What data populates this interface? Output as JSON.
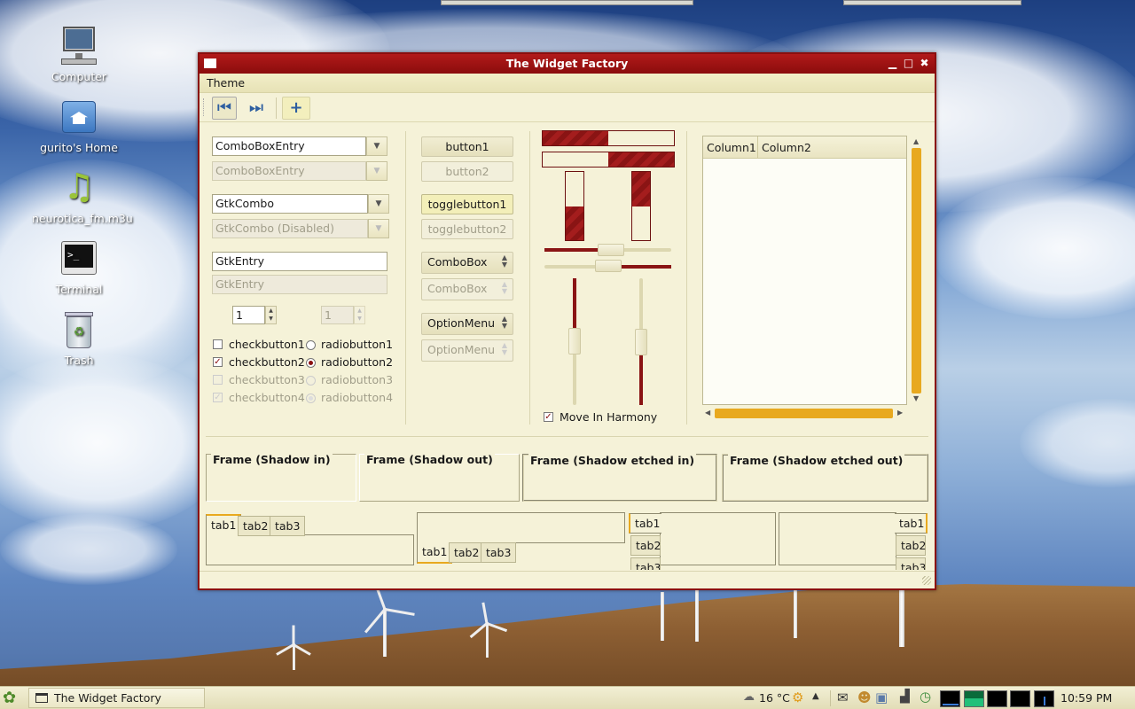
{
  "desktop": {
    "icons": [
      {
        "label": "Computer",
        "icon": "computer-icon"
      },
      {
        "label": "gurito's Home",
        "icon": "home-folder-icon"
      },
      {
        "label": "neurotica_fm.m3u",
        "icon": "music-file-icon"
      },
      {
        "label": "Terminal",
        "icon": "terminal-icon"
      },
      {
        "label": "Trash",
        "icon": "trash-icon"
      }
    ]
  },
  "window": {
    "title": "The Widget Factory",
    "menu": {
      "theme": "Theme"
    },
    "toolbar": [
      "go-first-icon",
      "go-last-icon",
      "add-icon"
    ]
  },
  "column1": {
    "combo_entry": "ComboBoxEntry",
    "combo_entry_disabled": "ComboBoxEntry",
    "gtk_combo": "GtkCombo",
    "gtk_combo_disabled": "GtkCombo (Disabled)",
    "entry": "GtkEntry",
    "entry_disabled": "GtkEntry",
    "spin_value": "1",
    "spin_disabled_value": "1",
    "checks": [
      {
        "label": "checkbutton1",
        "checked": false,
        "disabled": false
      },
      {
        "label": "checkbutton2",
        "checked": true,
        "disabled": false
      },
      {
        "label": "checkbutton3",
        "checked": false,
        "disabled": true
      },
      {
        "label": "checkbutton4",
        "checked": true,
        "disabled": true
      }
    ],
    "radios": [
      {
        "label": "radiobutton1",
        "selected": false,
        "disabled": false
      },
      {
        "label": "radiobutton2",
        "selected": true,
        "disabled": false
      },
      {
        "label": "radiobutton3",
        "selected": false,
        "disabled": true
      },
      {
        "label": "radiobutton4",
        "selected": true,
        "disabled": true
      }
    ]
  },
  "column2": {
    "button1": "button1",
    "button2": "button2",
    "toggle1": "togglebutton1",
    "toggle2": "togglebutton2",
    "combobox": "ComboBox",
    "combobox_disabled": "ComboBox",
    "optionmenu": "OptionMenu",
    "optionmenu_disabled": "OptionMenu"
  },
  "column3": {
    "progress_h1": 0.5,
    "progress_h2": 0.5,
    "progress_v1": 0.5,
    "progress_v2": 0.5,
    "scale_h1": 0.5,
    "scale_h2": 0.5,
    "scale_v1": 0.5,
    "scale_v2": 0.5,
    "harmony_label": "Move In Harmony",
    "harmony_checked": true
  },
  "treeview": {
    "columns": [
      "Column1",
      "Column2"
    ]
  },
  "frames": [
    "Frame (Shadow in)",
    "Frame (Shadow out)",
    "Frame (Shadow etched in)",
    "Frame (Shadow etched out)"
  ],
  "notebooks": {
    "tabs": [
      "tab1",
      "tab2",
      "tab3"
    ]
  },
  "taskbar": {
    "window_button": "The Widget Factory",
    "weather": "16 °C",
    "clock": "10:59 PM"
  },
  "colors": {
    "accent": "#8a0f0f",
    "scrollbar": "#e8a91f",
    "window_bg": "#f5f2d8"
  }
}
